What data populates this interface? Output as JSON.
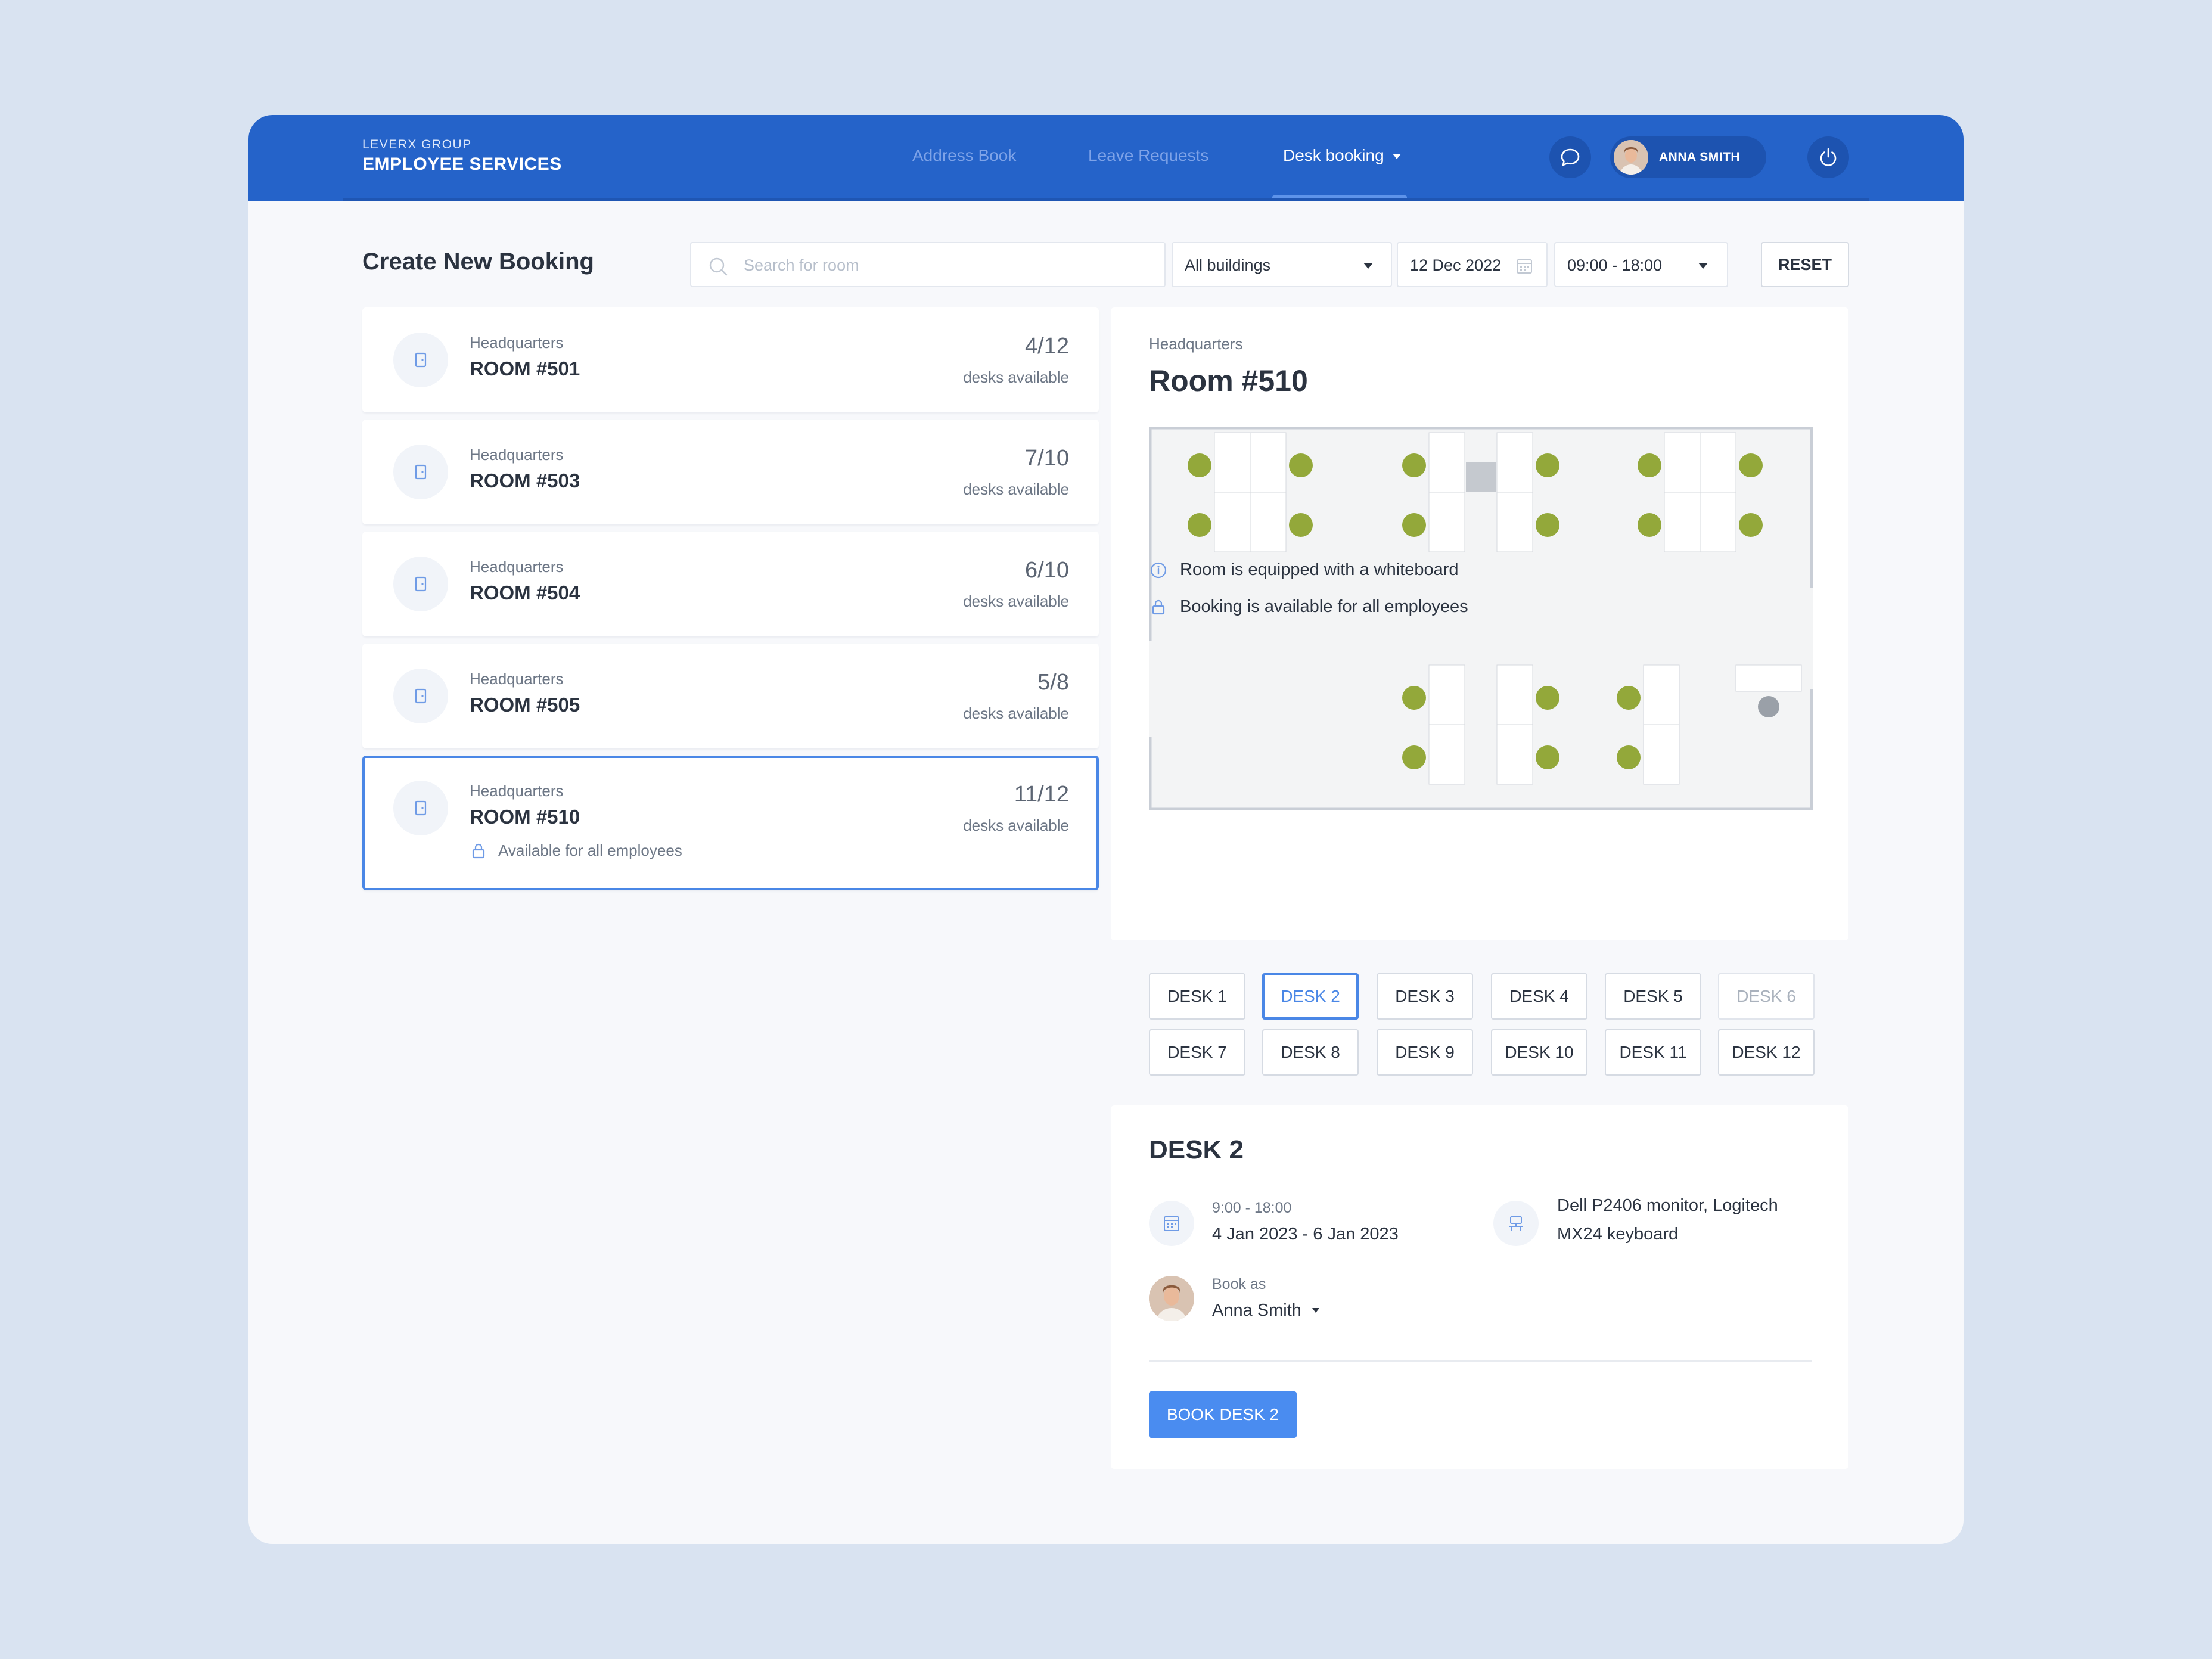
{
  "header": {
    "brand_small": "LEVERX GROUP",
    "brand_big": "EMPLOYEE SERVICES",
    "nav": [
      {
        "label": "Address Book"
      },
      {
        "label": "Leave Requests"
      },
      {
        "label": "Desk booking"
      }
    ],
    "user_name": "ANNA SMITH"
  },
  "toolbar": {
    "title": "Create New Booking",
    "search_placeholder": "Search for room",
    "building_select": "All buildings",
    "date": "12 Dec 2022",
    "time_select": "09:00 - 18:00",
    "reset_label": "RESET"
  },
  "rooms": [
    {
      "building": "Headquarters",
      "name": "ROOM #501",
      "count": "4/12",
      "count_label": "desks available"
    },
    {
      "building": "Headquarters",
      "name": "ROOM #503",
      "count": "7/10",
      "count_label": "desks available"
    },
    {
      "building": "Headquarters",
      "name": "ROOM #504",
      "count": "6/10",
      "count_label": "desks available"
    },
    {
      "building": "Headquarters",
      "name": "ROOM #505",
      "count": "5/8",
      "count_label": "desks available"
    },
    {
      "building": "Headquarters",
      "name": "ROOM #510",
      "count": "11/12",
      "count_label": "desks available",
      "badge": "Available for all employees"
    }
  ],
  "detail": {
    "building": "Headquarters",
    "room": "Room #510",
    "features": [
      {
        "icon": "info-icon",
        "text": "Room is equipped with a whiteboard"
      },
      {
        "icon": "lock-icon",
        "text": "Booking is available for all employees"
      }
    ]
  },
  "desks": [
    {
      "label": "DESK 1",
      "state": "normal"
    },
    {
      "label": "DESK 2",
      "state": "selected"
    },
    {
      "label": "DESK 3",
      "state": "normal"
    },
    {
      "label": "DESK 4",
      "state": "normal"
    },
    {
      "label": "DESK 5",
      "state": "normal"
    },
    {
      "label": "DESK 6",
      "state": "disabled"
    },
    {
      "label": "DESK 7",
      "state": "normal"
    },
    {
      "label": "DESK 8",
      "state": "normal"
    },
    {
      "label": "DESK 9",
      "state": "normal"
    },
    {
      "label": "DESK 10",
      "state": "normal"
    },
    {
      "label": "DESK 11",
      "state": "normal"
    },
    {
      "label": "DESK 12",
      "state": "normal"
    }
  ],
  "desk_detail": {
    "title": "DESK 2",
    "time": "9:00 - 18:00",
    "dates": "4 Jan 2023 - 6 Jan 2023",
    "equipment_line1": "Dell P2406 monitor, Logitech",
    "equipment_line2": "MX24 keyboard",
    "book_as_label": "Book as",
    "book_as_name": "Anna Smith",
    "book_button": "BOOK DESK 2"
  },
  "colors": {
    "header_bg": "#2563c9",
    "accent": "#4a87e6",
    "primary_button": "#4a8cf0",
    "page_bg": "#d9e3f1"
  }
}
